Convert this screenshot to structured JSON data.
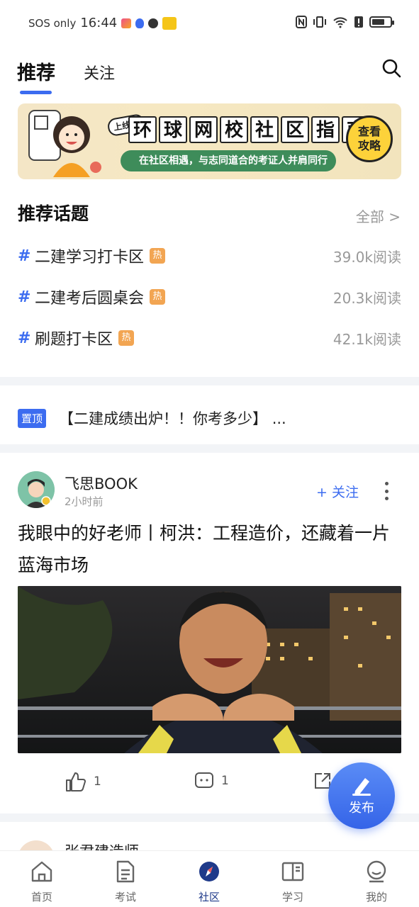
{
  "status_bar": {
    "carrier": "SOS only",
    "time": "16:44",
    "battery_level": 0.7
  },
  "top_tabs": [
    {
      "label": "推荐",
      "active": true
    },
    {
      "label": "关注",
      "active": false
    }
  ],
  "banner": {
    "tag": "上线了",
    "title_chars": [
      "环",
      "球",
      "网",
      "校",
      "社",
      "区",
      "指",
      "南"
    ],
    "subtitle": "在社区相遇，与志同道合的考证人并肩同行",
    "cta": "查看攻略"
  },
  "topics": {
    "heading": "推荐话题",
    "all_label": "全部 >",
    "items": [
      {
        "hash": "#",
        "name": "二建学习打卡区",
        "hot": "热",
        "reads": "39.0k阅读"
      },
      {
        "hash": "#",
        "name": "二建考后圆桌会",
        "hot": "热",
        "reads": "20.3k阅读"
      },
      {
        "hash": "#",
        "name": "刷题打卡区",
        "hot": "热",
        "reads": "42.1k阅读"
      }
    ]
  },
  "pinned": {
    "badge": "置顶",
    "text": "【二建成绩出炉！！你考多少】 ..."
  },
  "post": {
    "author": "飞思BOOK",
    "time": "2小时前",
    "follow_label": "+ 关注",
    "title": "我眼中的好老师丨柯洪：工程造价，还藏着一片蓝海市场",
    "likes": "1",
    "comments": "1"
  },
  "next_post": {
    "author": "张君建造师"
  },
  "fab": {
    "label": "发布"
  },
  "bottom_nav": [
    {
      "label": "首页",
      "icon": "home-icon",
      "active": false
    },
    {
      "label": "考试",
      "icon": "exam-doc-icon",
      "active": false
    },
    {
      "label": "社区",
      "icon": "compass-icon",
      "active": true
    },
    {
      "label": "学习",
      "icon": "book-icon",
      "active": false
    },
    {
      "label": "我的",
      "icon": "profile-icon",
      "active": false
    }
  ],
  "colors": {
    "accent": "#3c6cf0",
    "hot_badge": "#f2a552",
    "muted_text": "#999999",
    "divider": "#f2f4f7",
    "active_nav": "#1f3a8a"
  }
}
